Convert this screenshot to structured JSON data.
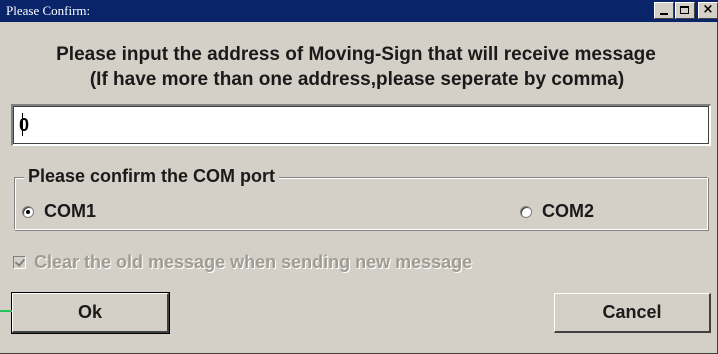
{
  "window": {
    "title": "Please Confirm:",
    "controls": [
      "minimize",
      "maximize",
      "close"
    ],
    "close_glyph": "×"
  },
  "prompt": {
    "line1": "Please input the address of Moving-Sign that will receive message",
    "line2": "(If have more than one address,please seperate by comma)"
  },
  "address_input": {
    "value": "0"
  },
  "com_group": {
    "legend": "Please confirm the COM port",
    "options": [
      {
        "label": "COM1",
        "selected": true
      },
      {
        "label": "COM2",
        "selected": false
      }
    ]
  },
  "clear_checkbox": {
    "label": "Clear the old message when sending new message",
    "checked": true,
    "enabled": false
  },
  "buttons": {
    "ok_label": "Ok",
    "cancel_label": "Cancel"
  },
  "colors": {
    "titlebar": "#0a246a",
    "face": "#d4d0c8",
    "disabled_text": "#a09c94",
    "pointer": "#22c55e"
  }
}
